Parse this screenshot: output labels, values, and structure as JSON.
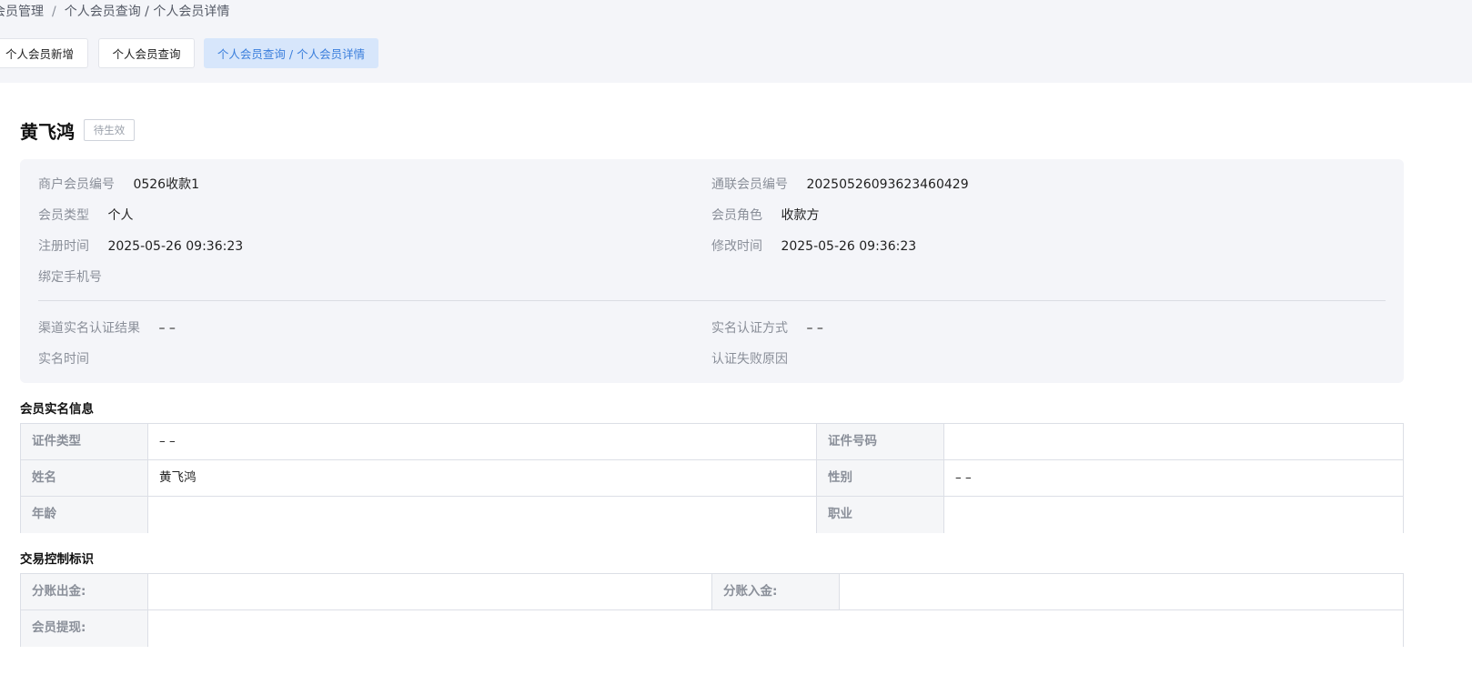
{
  "breadcrumb": {
    "items": [
      "会员管理",
      "个人会员查询 / 个人会员详情"
    ],
    "separator": "/"
  },
  "tabs": [
    {
      "label": "个人会员新增"
    },
    {
      "label": "个人会员查询"
    },
    {
      "label": "个人会员查询 / 个人会员详情"
    }
  ],
  "member": {
    "name": "黄飞鸿",
    "status": "待生效"
  },
  "info": {
    "merchant_no_label": "商户会员编号",
    "merchant_no": "0526收款1",
    "tonglian_no_label": "通联会员编号",
    "tonglian_no": "20250526093623460429",
    "member_type_label": "会员类型",
    "member_type": "个人",
    "member_role_label": "会员角色",
    "member_role": "收款方",
    "register_time_label": "注册时间",
    "register_time": "2025-05-26 09:36:23",
    "modify_time_label": "修改时间",
    "modify_time": "2025-05-26 09:36:23",
    "phone_label": "绑定手机号",
    "phone": "",
    "channel_result_label": "渠道实名认证结果",
    "channel_result": "– –",
    "auth_method_label": "实名认证方式",
    "auth_method": "– –",
    "auth_time_label": "实名时间",
    "auth_time": "",
    "fail_reason_label": "认证失败原因",
    "fail_reason": ""
  },
  "realname": {
    "title": "会员实名信息",
    "id_type_label": "证件类型",
    "id_type": "– –",
    "id_no_label": "证件号码",
    "id_no": "",
    "name_label": "姓名",
    "name": "黄飞鸿",
    "gender_label": "性别",
    "gender": "– –",
    "age_label": "年龄",
    "age": "",
    "job_label": "职业",
    "job": ""
  },
  "trade": {
    "title": "交易控制标识",
    "split_out_label": "分账出金:",
    "split_out": "",
    "split_in_label": "分账入金:",
    "split_in": "",
    "withdraw_label": "会员提现:",
    "withdraw": ""
  },
  "colors": {
    "accent": "#3b7fdc",
    "active_tab_bg": "#d7e6fb",
    "panel_bg": "#f4f5f9"
  }
}
